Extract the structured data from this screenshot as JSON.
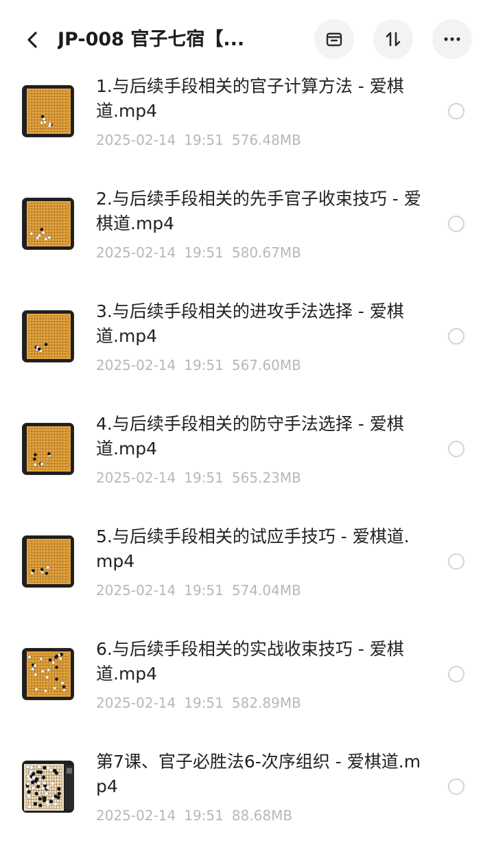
{
  "header": {
    "title": "JP-008 官子七宿【...",
    "icons": {
      "back": "back-arrow-icon",
      "select": "select-box-icon",
      "sort": "sort-icon",
      "more": "more-dots-icon"
    }
  },
  "colors": {
    "meta_text": "#b4b8bf",
    "board": "#e7a63e",
    "button_bg": "#f2f3f5"
  },
  "files": [
    {
      "name": "1.与后续手段相关的官子计算方法 - 爱棋道.mp4",
      "date": "2025-02-14",
      "time": "19:51",
      "size": "576.48MB",
      "thumb": "go-board-thumbnail"
    },
    {
      "name": "2.与后续手段相关的先手官子收束技巧 - 爱棋道.mp4",
      "date": "2025-02-14",
      "time": "19:51",
      "size": "580.67MB",
      "thumb": "go-board-thumbnail"
    },
    {
      "name": "3.与后续手段相关的进攻手法选择 - 爱棋道.mp4",
      "date": "2025-02-14",
      "time": "19:51",
      "size": "567.60MB",
      "thumb": "go-board-thumbnail"
    },
    {
      "name": "4.与后续手段相关的防守手法选择 - 爱棋道.mp4",
      "date": "2025-02-14",
      "time": "19:51",
      "size": "565.23MB",
      "thumb": "go-board-thumbnail"
    },
    {
      "name": "5.与后续手段相关的试应手技巧 - 爱棋道.mp4",
      "date": "2025-02-14",
      "time": "19:51",
      "size": "574.04MB",
      "thumb": "go-board-thumbnail"
    },
    {
      "name": "6.与后续手段相关的实战收束技巧 - 爱棋道.mp4",
      "date": "2025-02-14",
      "time": "19:51",
      "size": "582.89MB",
      "thumb": "go-board-thumbnail"
    },
    {
      "name": "第7课、官子必胜法6-次序组织 - 爱棋道.mp4",
      "date": "2025-02-14",
      "time": "19:51",
      "size": "88.68MB",
      "thumb": "go-board-thumbnail"
    }
  ]
}
